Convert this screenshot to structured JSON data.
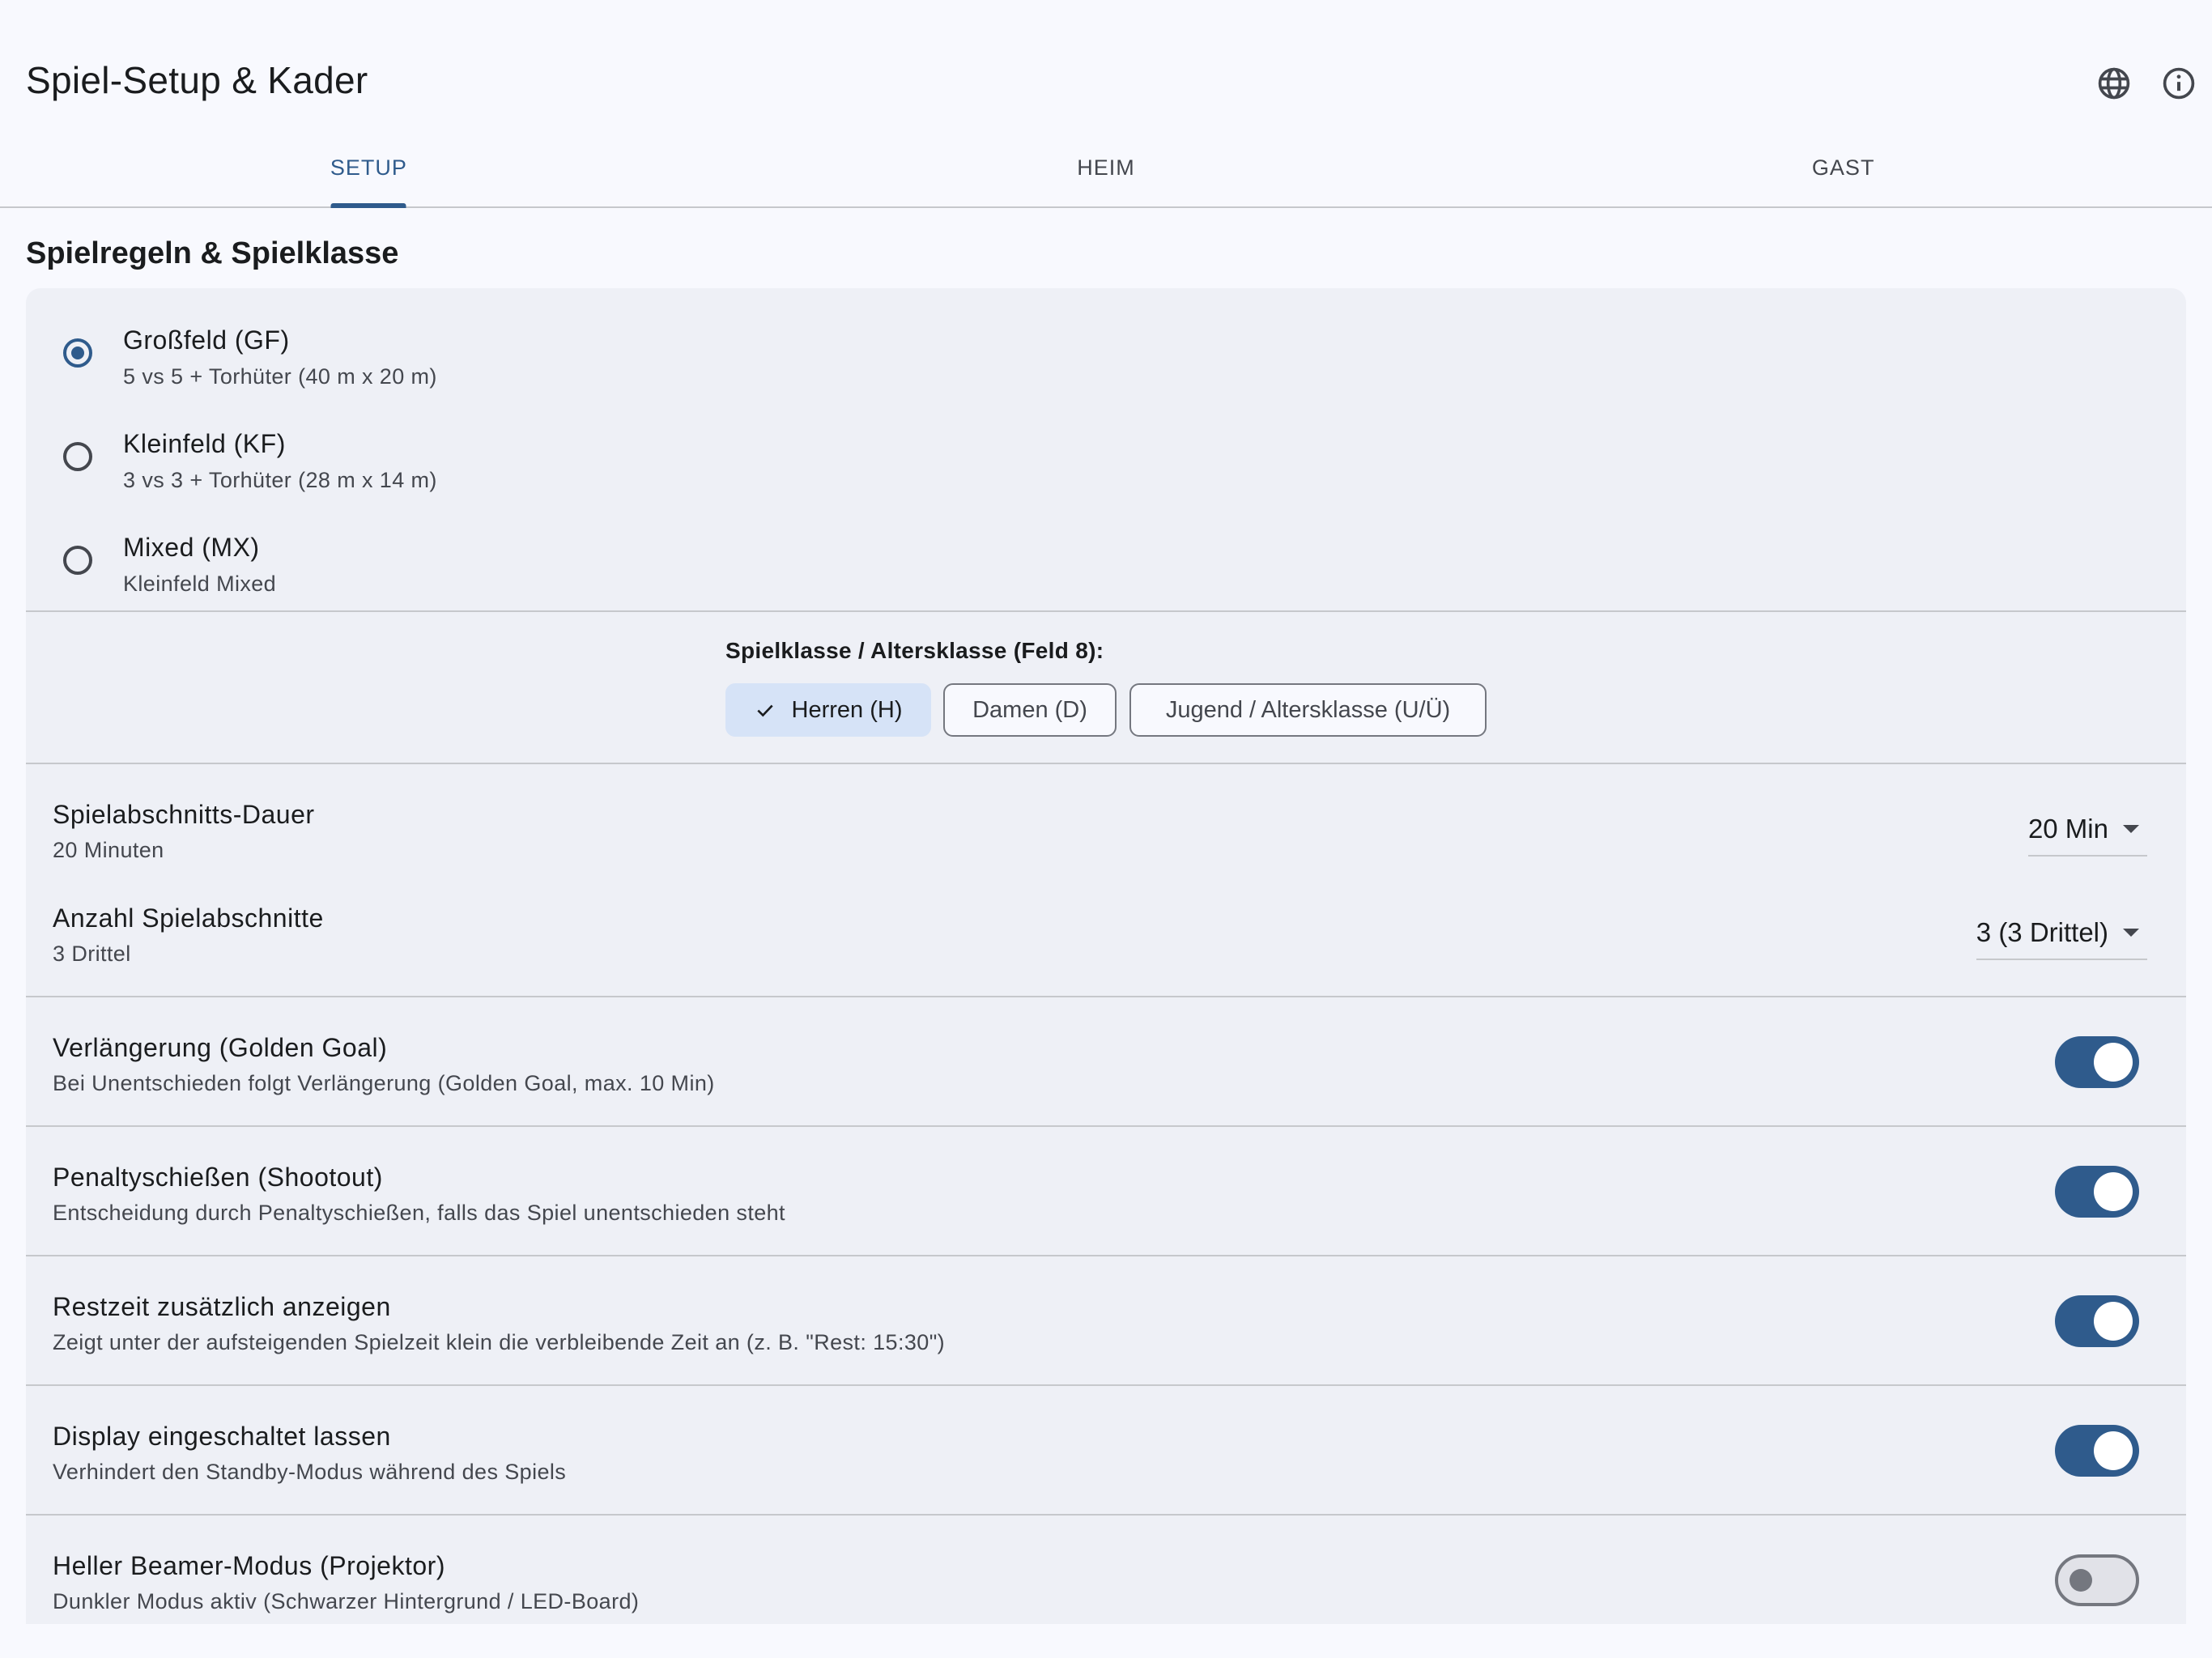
{
  "appbar": {
    "title": "Spiel-Setup & Kader",
    "actions": [
      "globe-icon",
      "info-icon"
    ]
  },
  "tabs": [
    {
      "label": "SETUP",
      "active": true
    },
    {
      "label": "HEIM",
      "active": false
    },
    {
      "label": "GAST",
      "active": false
    }
  ],
  "section": {
    "title": "Spielregeln & Spielklasse"
  },
  "game_types": [
    {
      "title": "Großfeld (GF)",
      "subtitle": "5 vs 5 + Torhüter (40 m x 20 m)",
      "checked": true
    },
    {
      "title": "Kleinfeld (KF)",
      "subtitle": "3 vs 3 + Torhüter (28 m x 14 m)",
      "checked": false
    },
    {
      "title": "Mixed (MX)",
      "subtitle": "Kleinfeld Mixed",
      "checked": false
    }
  ],
  "game_class": {
    "label": "Spielklasse / Altersklasse (Feld 8):",
    "chips": [
      {
        "label": "Herren (H)",
        "selected": true
      },
      {
        "label": "Damen (D)",
        "selected": false
      },
      {
        "label": "Jugend / Altersklasse (U/Ü)",
        "selected": false
      }
    ]
  },
  "period_duration": {
    "title": "Spielabschnitts-Dauer",
    "subtitle": "20 Minuten",
    "value": "20 Min"
  },
  "period_count": {
    "title": "Anzahl Spielabschnitte",
    "subtitle": "3 Drittel",
    "value": "3 (3 Drittel)"
  },
  "toggles": [
    {
      "title": "Verlängerung (Golden Goal)",
      "subtitle": "Bei Unentschieden folgt Verlängerung (Golden Goal, max. 10 Min)",
      "on": true
    },
    {
      "title": "Penaltyschießen (Shootout)",
      "subtitle": "Entscheidung durch Penaltyschießen, falls das Spiel unentschieden steht",
      "on": true
    },
    {
      "title": "Restzeit zusätzlich anzeigen",
      "subtitle": "Zeigt unter der aufsteigenden Spielzeit klein die verbleibende Zeit an (z. B. \"Rest: 15:30\")",
      "on": true
    },
    {
      "title": "Display eingeschaltet lassen",
      "subtitle": "Verhindert den Standby-Modus während des Spiels",
      "on": true
    },
    {
      "title": "Heller Beamer-Modus (Projektor)",
      "subtitle": "Dunkler Modus aktiv (Schwarzer Hintergrund / LED-Board)",
      "on": false
    }
  ],
  "colors": {
    "primary": "#2f5b8c",
    "background": "#f8f9fe",
    "panel": "#eef0f6",
    "chip_selected": "#d6e3f7"
  }
}
